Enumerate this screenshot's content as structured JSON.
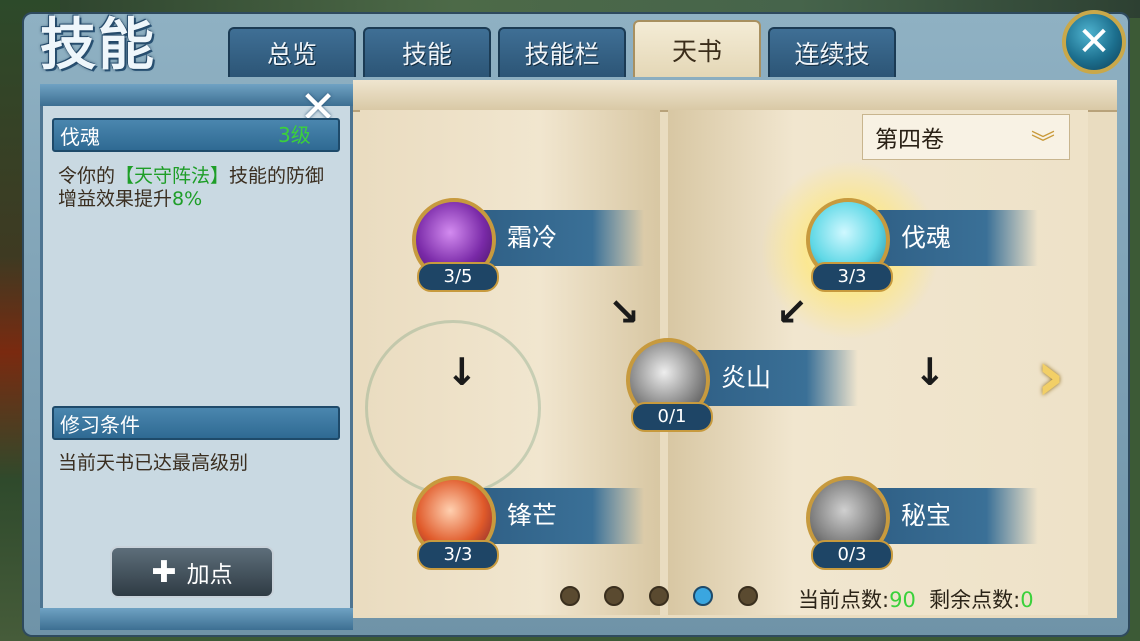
{
  "header": {
    "logo_text": "技能",
    "tabs": [
      {
        "label": "总览",
        "active": false
      },
      {
        "label": "技能",
        "active": false
      },
      {
        "label": "技能栏",
        "active": false
      },
      {
        "label": "天书",
        "active": true
      },
      {
        "label": "连续技",
        "active": false
      }
    ],
    "close_icon": "close-icon"
  },
  "detail": {
    "skill_name": "伐魂",
    "skill_level": "3级",
    "desc_part1": "令你的",
    "desc_highlight": "【天守阵法】",
    "desc_part2": "技能的防御增益效果提升",
    "desc_value": "8%",
    "condition_title": "修习条件",
    "condition_text": "当前天书已达最高级别",
    "add_button": "加点"
  },
  "book": {
    "volume": "第四卷",
    "skills": [
      {
        "name": "霜冷",
        "count": "3/5",
        "color": "#7a2aa8"
      },
      {
        "name": "伐魂",
        "count": "3/3",
        "color": "#5fd8e6"
      },
      {
        "name": "炎山",
        "count": "0/1",
        "color": "#8a8a8a"
      },
      {
        "name": "锋芒",
        "count": "3/3",
        "color": "#e05a2a"
      },
      {
        "name": "秘宝",
        "count": "0/3",
        "color": "#7c7c7c"
      }
    ],
    "page_dots": 5,
    "active_page": 4
  },
  "points": {
    "current_label": "当前点数:",
    "current_value": "90",
    "remain_label": "剩余点数:",
    "remain_value": "0"
  }
}
